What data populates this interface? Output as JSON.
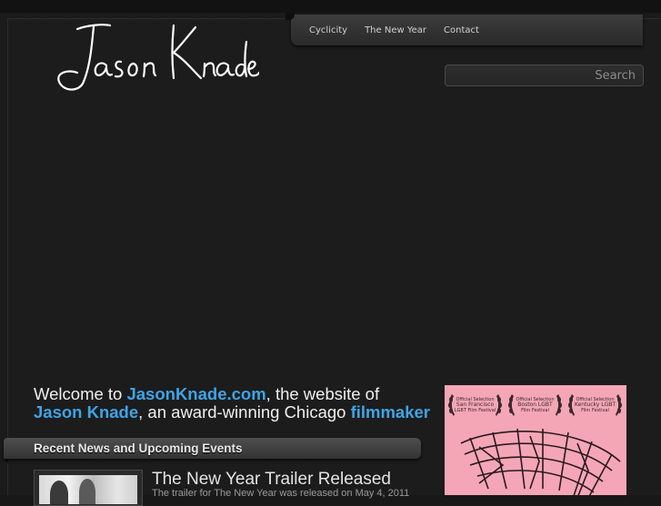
{
  "site": {
    "logo_text": "Jason Knade"
  },
  "nav": {
    "items": [
      {
        "label": "Cyclicity"
      },
      {
        "label": "The New Year"
      },
      {
        "label": "Contact"
      }
    ]
  },
  "search": {
    "value": "",
    "button_label": "Search"
  },
  "welcome": {
    "part1": "Welcome to ",
    "link1": "JasonKnade.com",
    "part2": ", the website of",
    "link2": "Jason Knade",
    "part3": ", an award-winning Chicago ",
    "link3": "filmmaker"
  },
  "news_section": {
    "title": "Recent News and Upcoming Events",
    "items": [
      {
        "title": "The New Year Trailer Released",
        "excerpt": "The trailer for The New Year was released on May 4, 2011"
      }
    ]
  },
  "poster": {
    "laurels": [
      {
        "line1": "Official Selection",
        "line2": "San Francisco",
        "line3": "LGBT Film Festival"
      },
      {
        "line1": "Official Selection",
        "line2": "Boston LGBT",
        "line3": "Film Festival"
      },
      {
        "line1": "Official Selection",
        "line2": "Kentucky LGBT",
        "line3": "Film Festival"
      }
    ]
  },
  "colors": {
    "accent": "#3fa4e6",
    "poster_pink": "#f4a6b6",
    "background": "#1c1c1c"
  }
}
